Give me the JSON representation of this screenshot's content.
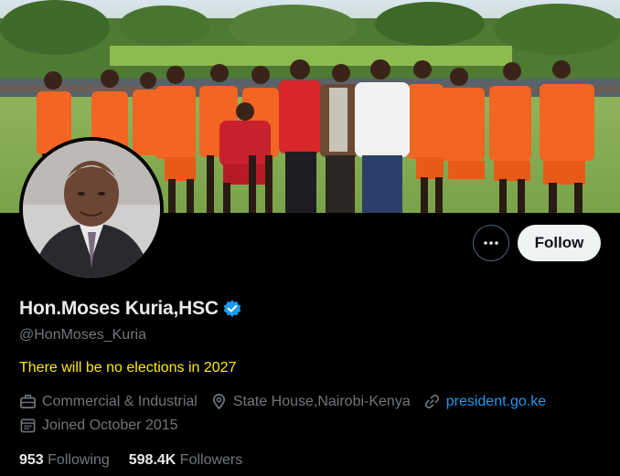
{
  "profile": {
    "display_name": "Hon.Moses Kuria,HSC",
    "handle": "@HonMoses_Kuria",
    "bio": "There will be no elections in 2027",
    "verified": true,
    "category": "Commercial & Industrial",
    "location": "State House,Nairobi-Kenya",
    "website": "president.go.ke",
    "joined": "Joined October 2015"
  },
  "stats": {
    "following_count": "953",
    "following_label": "Following",
    "followers_count": "598.4K",
    "followers_label": "Followers"
  },
  "actions": {
    "follow_label": "Follow",
    "more_icon": "more-dots-icon"
  },
  "colors": {
    "background": "#000000",
    "accent": "#1d9bf0",
    "bio_text": "#ffea00",
    "secondary_text": "#71767b",
    "jersey": "#f26522"
  }
}
